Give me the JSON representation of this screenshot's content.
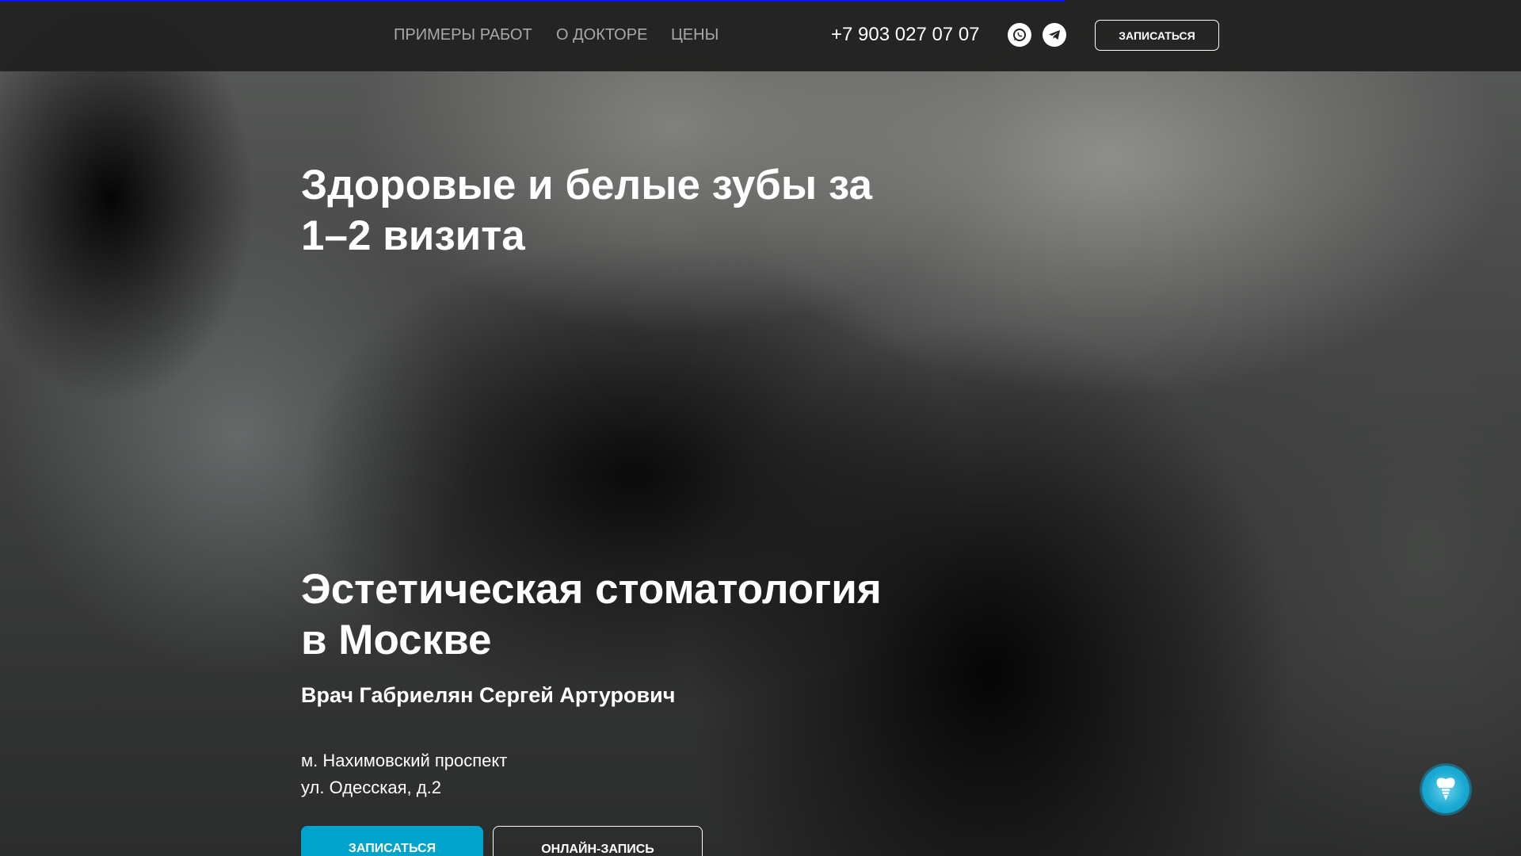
{
  "scroll_progress_percent": 70,
  "header": {
    "nav": [
      "ПРИМЕРЫ РАБОТ",
      "О ДОКТОРЕ",
      "ЦЕНЫ"
    ],
    "phone": "+7 903 027 07 07",
    "cta": "ЗАПИСАТЬСЯ",
    "icons": [
      "whatsapp-icon",
      "telegram-icon"
    ]
  },
  "hero": {
    "title_1": "Здоровые и белые зубы за",
    "title_2": "1–2 визита",
    "subtitle_1": "Эстетическая стоматология",
    "subtitle_2": "в Москве",
    "doctor": "Врач Габриелян Сергей Артурович",
    "address_1": "м. Нахимовский проспект",
    "address_2": "ул. Одесская, д.2",
    "btn_primary": "ЗАПИСАТЬСЯ",
    "btn_secondary": "ОНЛАЙН-ЗАПИСЬ"
  },
  "colors": {
    "accent": "#00a3cc",
    "progress": "#0a14ff",
    "header": "#222222"
  }
}
